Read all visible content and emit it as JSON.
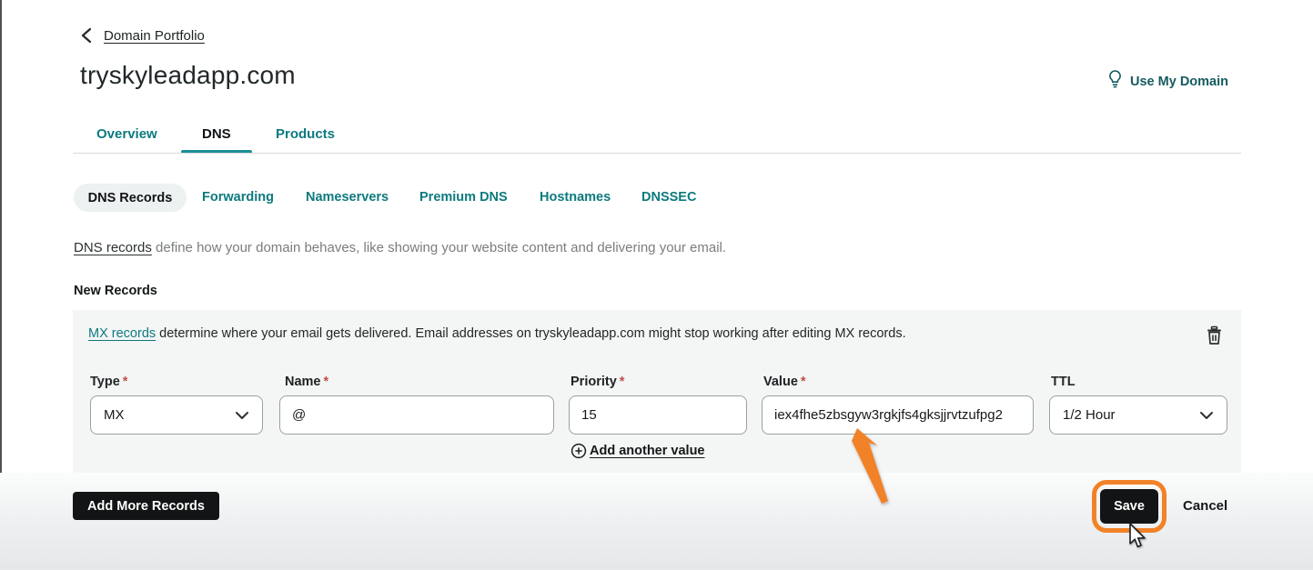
{
  "header": {
    "back_label": "Domain Portfolio",
    "domain_title": "tryskyleadapp.com",
    "use_my_domain_label": "Use My Domain"
  },
  "tabs": [
    {
      "label": "Overview",
      "active": false
    },
    {
      "label": "DNS",
      "active": true
    },
    {
      "label": "Products",
      "active": false
    }
  ],
  "subtabs": [
    {
      "label": "DNS Records",
      "active": true
    },
    {
      "label": "Forwarding",
      "active": false
    },
    {
      "label": "Nameservers",
      "active": false
    },
    {
      "label": "Premium DNS",
      "active": false
    },
    {
      "label": "Hostnames",
      "active": false
    },
    {
      "label": "DNSSEC",
      "active": false
    }
  ],
  "description": {
    "link_text": "DNS records",
    "rest_text": " define how your domain behaves, like showing your website content and delivering your email."
  },
  "new_records": {
    "heading": "New Records",
    "notice_link": "MX records",
    "notice_rest": " determine where your email gets delivered. Email addresses on tryskyleadapp.com might stop working after editing MX records."
  },
  "form": {
    "asterisk": "*",
    "type": {
      "label": "Type",
      "value": "MX"
    },
    "name": {
      "label": "Name",
      "value": "@"
    },
    "priority": {
      "label": "Priority",
      "value": "15"
    },
    "value": {
      "label": "Value",
      "value": "iex4fhe5zbsgyw3rgkjfs4gksjjrvtzufpg2"
    },
    "ttl": {
      "label": "TTL",
      "value": "1/2 Hour"
    },
    "add_another_value_label": "Add another value"
  },
  "footer": {
    "add_more_label": "Add More Records",
    "save_label": "Save",
    "cancel_label": "Cancel"
  },
  "colors": {
    "teal_link": "#0d7a7e",
    "tab_underline": "#1b8e93",
    "use_domain_teal": "#155b60",
    "button_black": "#121415",
    "annotation_orange": "#f28227",
    "card_background": "#f4f5f5",
    "required_red": "#c0504a"
  }
}
